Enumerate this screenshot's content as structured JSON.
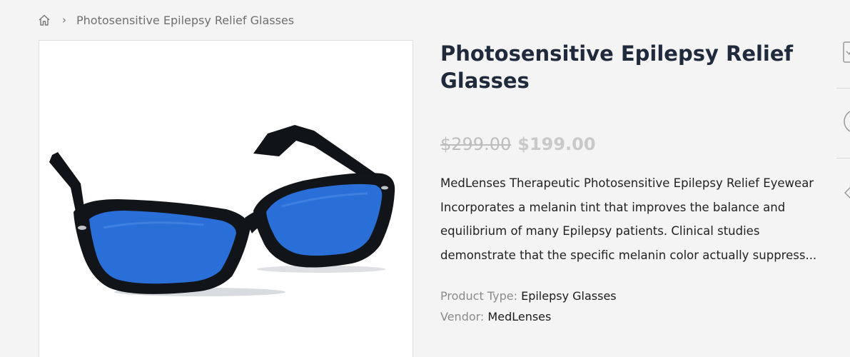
{
  "breadcrumb": {
    "home_icon": "home-icon",
    "separator": "›",
    "current": "Photosensitive Epilepsy Relief Glasses"
  },
  "product": {
    "title": "Photosensitive Epilepsy Relief Glasses",
    "price_original": "$299.00",
    "price_sale": "$199.00",
    "description": "MedLenses Therapeutic Photosensitive Epilepsy Relief Eyewear Incorporates a melanin tint that improves the balance and equilibrium of many Epilepsy patients. Clinical studies demonstrate that the specific melanin color actually suppress...",
    "product_type_label": "Product Type:",
    "product_type_value": "Epilepsy Glasses",
    "vendor_label": "Vendor:",
    "vendor_value": "MedLenses",
    "image": "glasses-blue-lenses-photo"
  },
  "colors": {
    "frame": "#111418",
    "lens": "#2a6fd8",
    "title": "#1f2a3c",
    "price_faded": "#c4c4c4"
  }
}
